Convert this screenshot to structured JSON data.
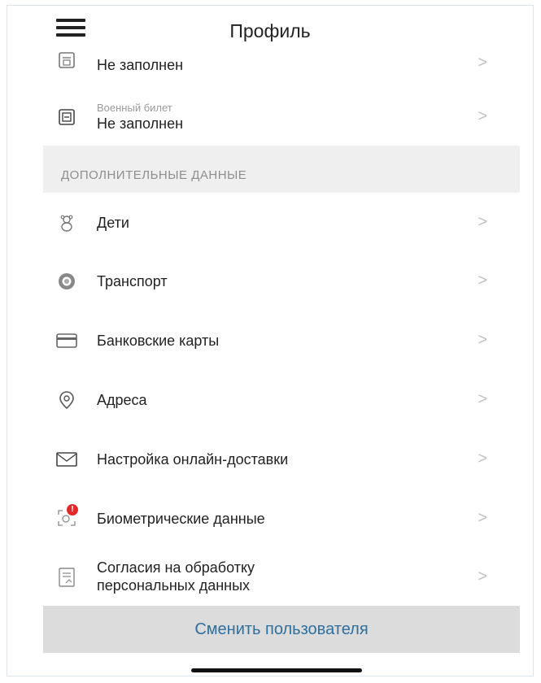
{
  "header": {
    "title": "Профиль"
  },
  "rows_top": [
    {
      "title": "",
      "value": "Не заполнен",
      "icon": "document-icon"
    },
    {
      "title": "Военный билет",
      "value": "Не заполнен",
      "icon": "military-id-icon"
    }
  ],
  "section": {
    "title": "ДОПОЛНИТЕЛЬНЫЕ ДАННЫЕ"
  },
  "items": [
    {
      "label": "Дети",
      "icon": "child-icon"
    },
    {
      "label": "Транспорт",
      "icon": "wheel-icon"
    },
    {
      "label": "Банковские карты",
      "icon": "card-icon"
    },
    {
      "label": "Адреса",
      "icon": "location-icon"
    },
    {
      "label": "Настройка онлайн-доставки",
      "icon": "envelope-icon"
    },
    {
      "label": "Биометрические данные",
      "icon": "biometric-icon",
      "badge": "!"
    },
    {
      "label": "Согласия на обработку персональных данных",
      "icon": "consent-doc-icon"
    }
  ],
  "footer": {
    "switch_user": "Сменить пользователя"
  },
  "chevron": ">",
  "colors": {
    "accent": "#2f6f9e",
    "section_bg": "#efefef",
    "button_bg": "#dcdcdc",
    "badge": "#e02a2a"
  }
}
